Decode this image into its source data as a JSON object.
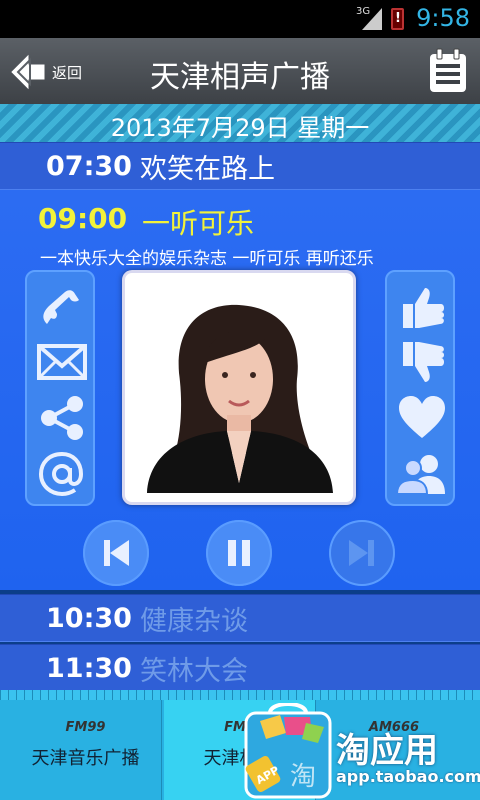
{
  "status_bar": {
    "network": "3G",
    "time": "9:58"
  },
  "header": {
    "back_label": "返回",
    "title": "天津相声广播"
  },
  "date_bar": {
    "date": "2013年7月29日  星期一"
  },
  "schedule": {
    "previous": {
      "time": "07:30",
      "name": "欢笑在路上"
    },
    "current": {
      "time": "09:00",
      "name": "一听可乐",
      "description": "一本快乐大全的娱乐杂志 一听可乐 再听还乐"
    },
    "next": [
      {
        "time": "10:30",
        "name": "健康杂谈"
      },
      {
        "time": "11:30",
        "name": "笑林大会"
      }
    ]
  },
  "left_actions": [
    "phone-icon",
    "mail-icon",
    "share-icon",
    "at-icon"
  ],
  "right_actions": [
    "thumbs-up-icon",
    "thumbs-down-icon",
    "heart-icon",
    "people-icon"
  ],
  "stations": [
    {
      "freq": "FM99",
      "name": "天津音乐广播"
    },
    {
      "freq": "FM9",
      "name": "天津相声"
    },
    {
      "freq": "AM666",
      "name": ""
    }
  ],
  "watermark": {
    "text": "淘应用",
    "url": "app.taobao.com",
    "badge": "APP",
    "glyph": "淘"
  },
  "colors": {
    "accent": "#33b5e5",
    "current_highlight": "#f2f23a",
    "panel": "#2c6cf2"
  }
}
